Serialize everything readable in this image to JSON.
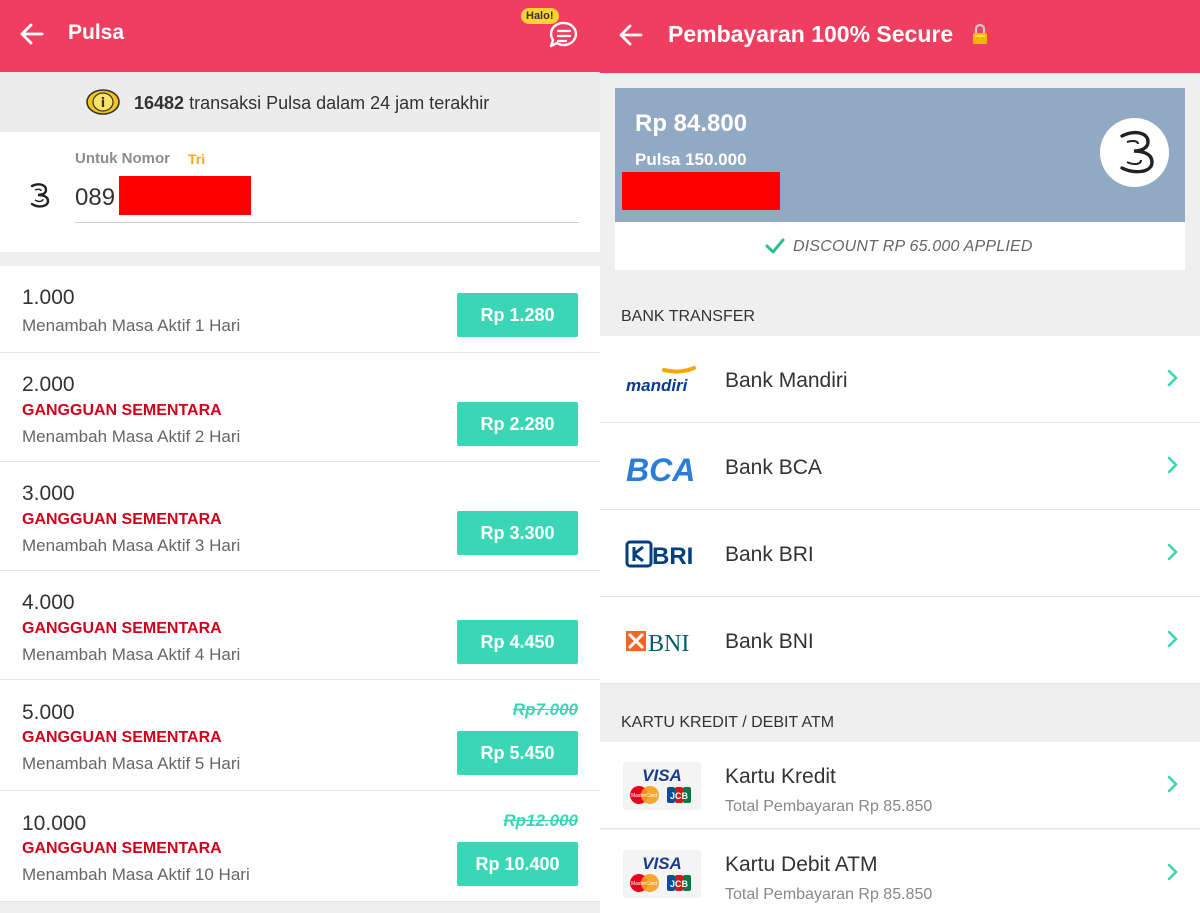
{
  "left": {
    "header": {
      "title": "Pulsa",
      "halo_badge": "Halo!"
    },
    "info": {
      "count": "16482",
      "text": "transaksi Pulsa dalam 24 jam terakhir"
    },
    "number": {
      "label": "Untuk Nomor",
      "operator": "Tri",
      "value": "089"
    },
    "products": [
      {
        "nominal": "1.000",
        "status": "",
        "desc": "Menambah Masa Aktif 1 Hari",
        "price": "Rp 1.280",
        "old_price": ""
      },
      {
        "nominal": "2.000",
        "status": "GANGGUAN SEMENTARA",
        "desc": "Menambah Masa Aktif 2 Hari",
        "price": "Rp 2.280",
        "old_price": ""
      },
      {
        "nominal": "3.000",
        "status": "GANGGUAN SEMENTARA",
        "desc": "Menambah Masa Aktif 3 Hari",
        "price": "Rp 3.300",
        "old_price": ""
      },
      {
        "nominal": "4.000",
        "status": "GANGGUAN SEMENTARA",
        "desc": "Menambah Masa Aktif 4 Hari",
        "price": "Rp 4.450",
        "old_price": ""
      },
      {
        "nominal": "5.000",
        "status": "GANGGUAN SEMENTARA",
        "desc": "Menambah Masa Aktif 5 Hari",
        "price": "Rp 5.450",
        "old_price": "Rp7.000"
      },
      {
        "nominal": "10.000",
        "status": "GANGGUAN SEMENTARA",
        "desc": "Menambah Masa Aktif 10 Hari",
        "price": "Rp 10.400",
        "old_price": "Rp12.000"
      }
    ]
  },
  "right": {
    "header": {
      "title": "Pembayaran 100% Secure"
    },
    "summary": {
      "amount": "Rp 84.800",
      "item": "Pulsa 150.000"
    },
    "discount": "DISCOUNT RP 65.000 APPLIED",
    "bank_section": "BANK TRANSFER",
    "banks": [
      {
        "logo_text": "mandiri",
        "name": "Bank Mandiri"
      },
      {
        "logo_text": "BCA",
        "name": "Bank BCA"
      },
      {
        "logo_text": "BRI",
        "name": "Bank BRI"
      },
      {
        "logo_text": "BNI",
        "name": "Bank BNI"
      }
    ],
    "card_section": "KARTU KREDIT / DEBIT ATM",
    "cards": [
      {
        "name": "Kartu Kredit",
        "total": "Total Pembayaran Rp 85.850",
        "visa": "VISA",
        "jcb": "JCB",
        "mc": "MasterCard"
      },
      {
        "name": "Kartu Debit ATM",
        "total": "Total Pembayaran Rp 85.850",
        "visa": "VISA",
        "jcb": "JCB",
        "mc": "MasterCard"
      }
    ]
  },
  "colors": {
    "header": "#ef3e5f",
    "accent": "#3bd6b6",
    "error": "#d0021b",
    "summary_bg": "#92a9c4"
  }
}
